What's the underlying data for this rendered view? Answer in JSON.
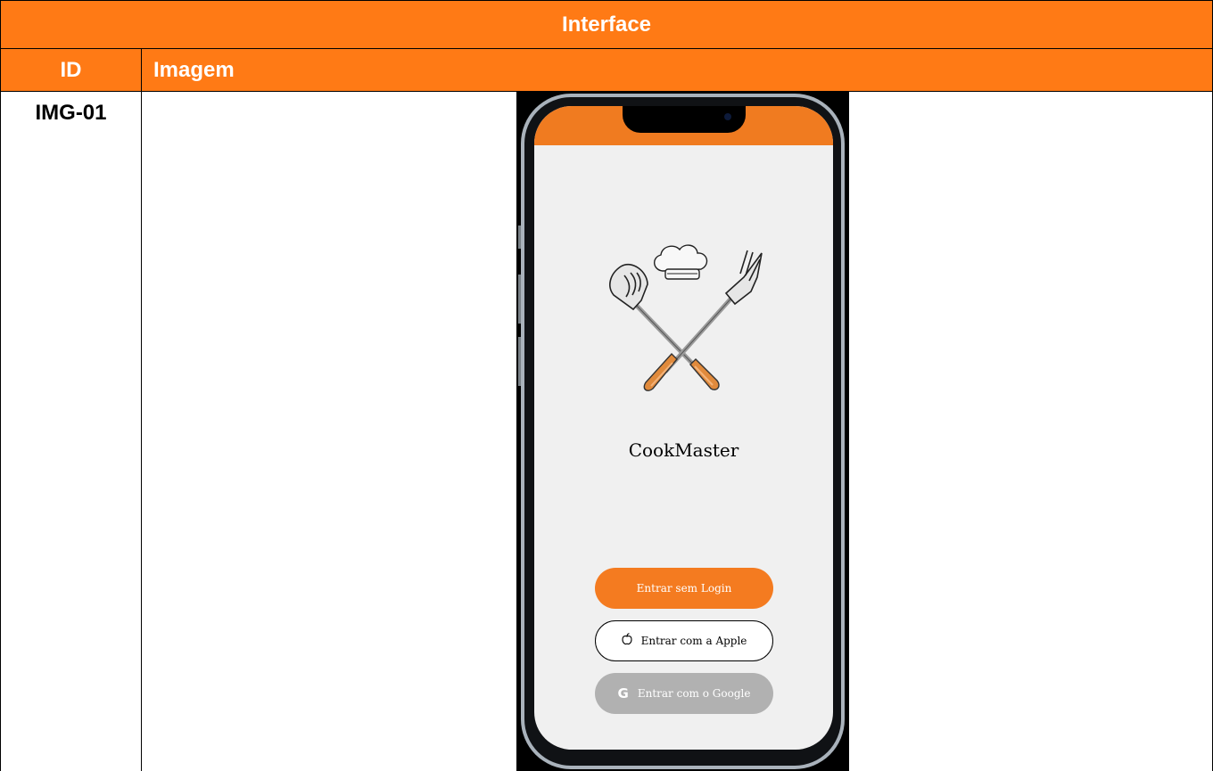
{
  "table": {
    "title": "Interface",
    "col_id": "ID",
    "col_image": "Imagem",
    "row_id": "IMG-01"
  },
  "app": {
    "name": "CookMaster",
    "buttons": {
      "guest": "Entrar sem Login",
      "apple": "Entrar com a Apple",
      "google": "Entrar com o Google"
    },
    "icons": {
      "logo": "crossed-spatula-fork-chef-hat-icon",
      "apple": "apple-icon",
      "google": "google-icon"
    },
    "colors": {
      "accent": "#F47B20",
      "header": "#FF7A15",
      "disabled_button": "#B1B1B1",
      "screen_bg": "#F0F0F0"
    }
  }
}
